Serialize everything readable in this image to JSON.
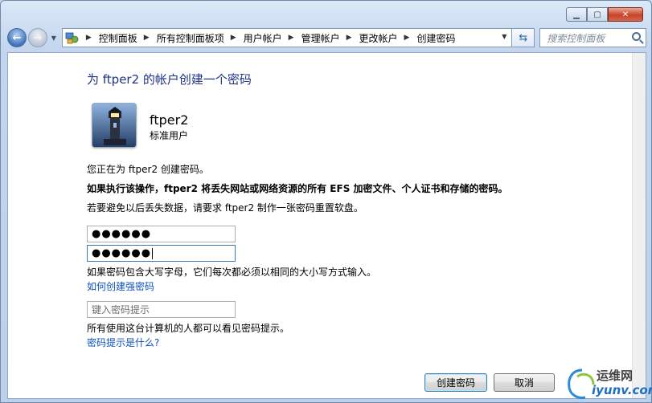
{
  "window": {
    "controls": {
      "minimize": "▁",
      "maximize": "▢",
      "close": "✕"
    }
  },
  "nav": {
    "back_icon": "back-arrow-icon",
    "forward_icon": "forward-arrow-icon",
    "breadcrumbs": [
      "控制面板",
      "所有控制面板项",
      "用户帐户",
      "管理帐户",
      "更改帐户",
      "创建密码"
    ],
    "search_placeholder": "搜索控制面板"
  },
  "page": {
    "title": "为 ftper2 的帐户创建一个密码",
    "user": {
      "name": "ftper2",
      "type": "标准用户"
    },
    "info_line": "您正在为 ftper2 创建密码。",
    "warning_line": "如果执行该操作，ftper2 将丢失网站或网络资源的所有 EFS 加密文件、个人证书和存储的密码。",
    "reset_disk_line": "若要避免以后丢失数据，请要求 ftper2 制作一张密码重置软盘。",
    "new_password_mask": "●●●●●●",
    "confirm_password_mask": "●●●●●●",
    "case_note": "如果密码包含大写字母，它们每次都必须以相同的大小写方式输入。",
    "strong_password_link": "如何创建强密码",
    "hint_placeholder": "键入密码提示",
    "hint_visibility_note": "所有使用这台计算机的人都可以看见密码提示。",
    "hint_help_link": "密码提示是什么?",
    "create_button": "创建密码",
    "cancel_button": "取消"
  },
  "watermark": {
    "top": "运维网",
    "bottom": "iyunv.com"
  }
}
